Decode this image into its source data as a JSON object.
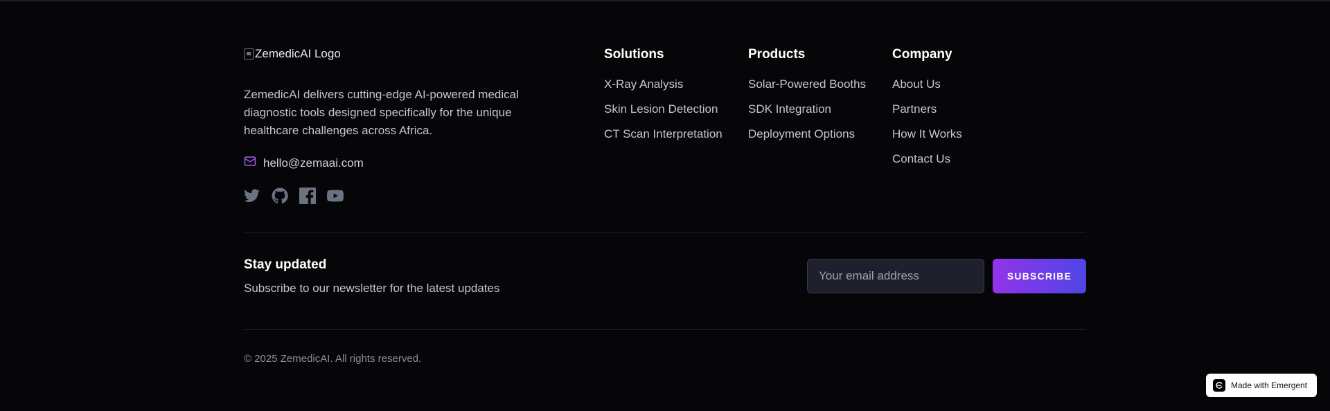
{
  "brand": {
    "logo_alt": "ZemedicAI Logo",
    "description": "ZemedicAI delivers cutting-edge AI-powered medical diagnostic tools designed specifically for the unique healthcare challenges across Africa.",
    "email": "hello@zemaai.com",
    "email_icon": "mail-icon",
    "accent_color": "#a855f7",
    "socials": [
      "twitter-icon",
      "github-icon",
      "facebook-icon",
      "youtube-icon"
    ]
  },
  "columns": {
    "solutions": {
      "title": "Solutions",
      "items": [
        "X-Ray Analysis",
        "Skin Lesion Detection",
        "CT Scan Interpretation"
      ]
    },
    "products": {
      "title": "Products",
      "items": [
        "Solar-Powered Booths",
        "SDK Integration",
        "Deployment Options"
      ]
    },
    "company": {
      "title": "Company",
      "items": [
        "About Us",
        "Partners",
        "How It Works",
        "Contact Us"
      ]
    }
  },
  "newsletter": {
    "title": "Stay updated",
    "subtitle": "Subscribe to our newsletter for the latest updates",
    "placeholder": "Your email address",
    "button_label": "SUBSCRIBE",
    "button_colors": [
      "#9333ea",
      "#4f46e5"
    ]
  },
  "copyright": "© 2025 ZemedicAI. All rights reserved.",
  "badge": {
    "label": "Made with Emergent",
    "icon": "emergent-logo-icon"
  }
}
